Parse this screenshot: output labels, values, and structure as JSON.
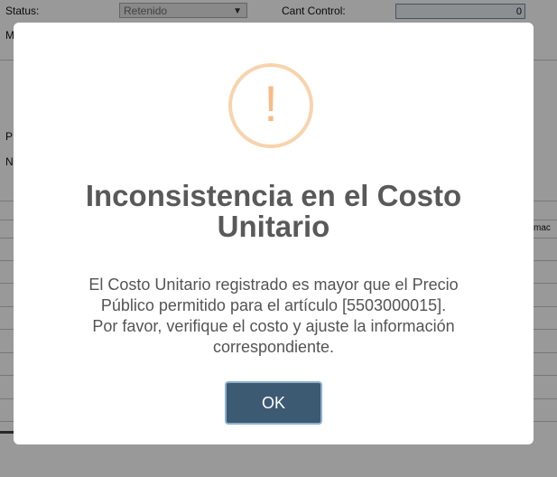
{
  "form": {
    "status_label": "Status:",
    "status_value": "Retenido",
    "cant_control_label": "Cant Control:",
    "cant_control_value": "0",
    "truncated_labels": [
      "M",
      "P",
      "N"
    ],
    "column_header_fragment": "mac"
  },
  "dialog": {
    "icon": "warning-exclamation-icon",
    "icon_glyph": "!",
    "title": "Inconsistencia en el Costo Unitario",
    "message_lines": [
      "El Costo Unitario registrado es mayor que el Precio",
      "Público permitido para el artículo [5503000015].",
      "Por favor, verifique el costo y ajuste la información",
      "correspondiente."
    ],
    "ok_label": "OK"
  },
  "colors": {
    "overlay": "#000000",
    "icon_ring": "#f8d3ad",
    "icon_mark": "#f8bb86",
    "ok_button": "#3d5a73",
    "ok_button_border": "#8cb1cc"
  }
}
